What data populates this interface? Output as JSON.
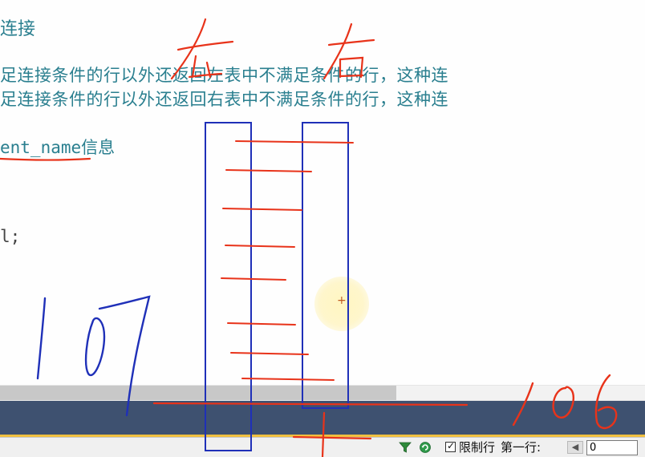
{
  "document": {
    "heading": "连接",
    "left_join_line": "足连接条件的行以外还返回左表中不满足条件的行，这种连",
    "right_join_line": "足连接条件的行以外还返回右表中不满足条件的行，这种连",
    "field_code": "ent_name",
    "field_suffix": "信息",
    "code_end": "l;"
  },
  "annotations": {
    "left_word": "左",
    "right_word": "右",
    "left_count": "107",
    "right_count": "106",
    "colors": {
      "ink_red": "#e8331a",
      "ink_blue": "#1f30b8",
      "text_teal": "#2a7f8f"
    }
  },
  "toolbar": {
    "filter_icon": "filter-icon",
    "refresh_icon": "refresh-icon",
    "limit_rows_checked": true,
    "limit_rows_label": "限制行",
    "first_row_label": "第一行:",
    "first_row_value": "0"
  },
  "colors": {
    "status_band": "#3e5170",
    "accent_line": "#f0c040"
  }
}
